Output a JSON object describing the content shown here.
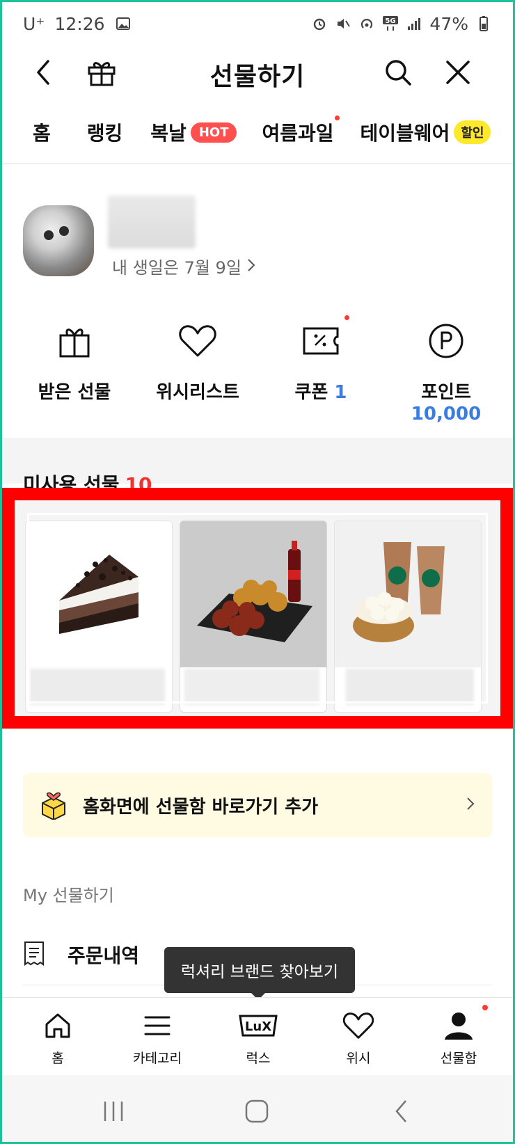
{
  "status": {
    "carrier": "U⁺",
    "time": "12:26",
    "network": "5G",
    "battery": "47%"
  },
  "header": {
    "title": "선물하기"
  },
  "tabs": [
    {
      "label": "홈"
    },
    {
      "label": "랭킹"
    },
    {
      "label": "복날",
      "badge": "HOT"
    },
    {
      "label": "여름과일"
    },
    {
      "label": "테이블웨어",
      "badge": "할인"
    }
  ],
  "profile": {
    "birthday": "내 생일은 7월 9일"
  },
  "quick_menu": [
    {
      "label": "받은 선물",
      "icon": "gift-box-icon"
    },
    {
      "label": "위시리스트",
      "icon": "heart-icon"
    },
    {
      "label": "쿠폰",
      "value": "1",
      "icon": "coupon-icon"
    },
    {
      "label": "포인트",
      "value": "10,000",
      "icon": "point-icon"
    }
  ],
  "unused": {
    "title": "미사용 선물",
    "count": "10",
    "cards": [
      {
        "icon": "chocolate-cake-image"
      },
      {
        "icon": "fried-chicken-and-cola-image"
      },
      {
        "icon": "coffee-and-cake-image"
      }
    ]
  },
  "shortcut_banner": {
    "text": "홈화면에 선물함 바로가기 추가"
  },
  "my_section": {
    "title": "My 선물하기",
    "order_history": "주문내역"
  },
  "tooltip": {
    "text": "럭셔리 브랜드 찾아보기"
  },
  "bottom_nav": [
    {
      "label": "홈",
      "icon": "home-icon"
    },
    {
      "label": "카테고리",
      "icon": "menu-icon"
    },
    {
      "label": "럭스",
      "icon": "lux-icon",
      "icon_text": "LuX"
    },
    {
      "label": "위시",
      "icon": "heart-icon"
    },
    {
      "label": "선물함",
      "icon": "person-icon"
    }
  ],
  "colors": {
    "accent_blue": "#3a7ce0",
    "highlight_red": "#ff0000",
    "hot_badge": "#ff4f4f",
    "sale_badge": "#fde82c",
    "banner_bg": "#fffbe2"
  }
}
